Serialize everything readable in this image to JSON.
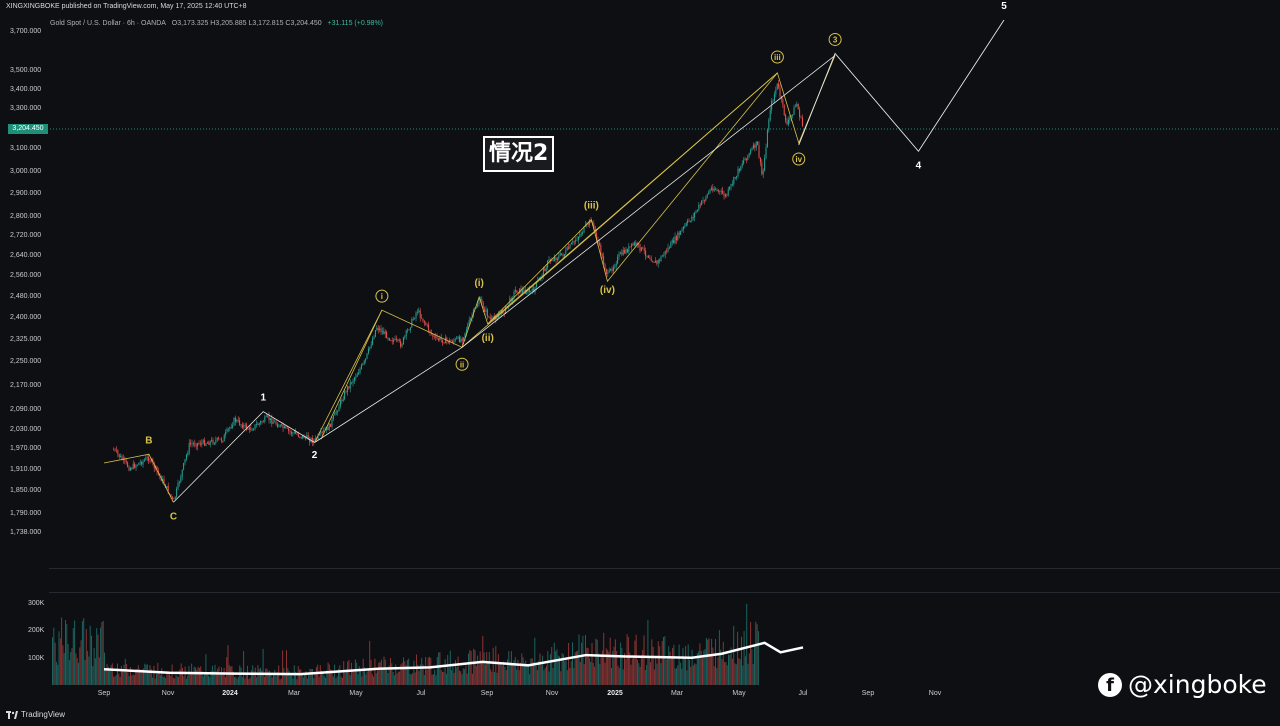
{
  "header": {
    "published": "XINGXINGBOKE published on TradingView.com, May 17, 2025 12:40 UTC+8",
    "symbol": "Gold Spot / U.S. Dollar · 6h · OANDA",
    "ohlc": "O3,173.325  H3,205.885  L3,172.815  C3,204.450",
    "change": "+31.115 (+0.98%)"
  },
  "overlay_title": "情况2",
  "brand": {
    "icon": "facebook-icon",
    "handle": "@xingboke"
  },
  "footer": {
    "logo": "TradingView"
  },
  "colors": {
    "background": "#0e0f12",
    "up": "#26a69a",
    "down": "#ef5350",
    "wave_yellow": "#d8c24a",
    "wave_white": "#e6e6e6",
    "current_price": "#1e8f78"
  },
  "chart_data": {
    "type": "candlestick",
    "title": "Gold Spot / U.S. Dollar · 6h · OANDA",
    "current_price": "3,204.450",
    "y_ticks": [
      "3,700.000",
      "3,500.000",
      "3,400.000",
      "3,300.000",
      "3,100.000",
      "3,000.000",
      "2,900.000",
      "2,800.000",
      "2,720.000",
      "2,640.000",
      "2,560.000",
      "2,480.000",
      "2,400.000",
      "2,325.000",
      "2,250.000",
      "2,170.000",
      "2,090.000",
      "2,030.000",
      "1,970.000",
      "1,910.000",
      "1,850.000",
      "1,790.000",
      "1,738.000"
    ],
    "x_ticks": [
      "Sep",
      "Nov",
      "2024",
      "Mar",
      "May",
      "Jul",
      "Sep",
      "Nov",
      "2025",
      "Mar",
      "May",
      "Jul",
      "Sep",
      "Nov"
    ],
    "volume_ticks": [
      "300K",
      "200K",
      "100K"
    ],
    "price_path": [
      [
        "2023-08-10",
        1968
      ],
      [
        "2023-08-25",
        1915
      ],
      [
        "2023-09-12",
        1945
      ],
      [
        "2023-09-28",
        1862
      ],
      [
        "2023-10-05",
        1820
      ],
      [
        "2023-10-20",
        1985
      ],
      [
        "2023-11-05",
        1990
      ],
      [
        "2023-11-20",
        2000
      ],
      [
        "2023-12-01",
        2060
      ],
      [
        "2023-12-15",
        2030
      ],
      [
        "2024-01-01",
        2065
      ],
      [
        "2024-01-20",
        2025
      ],
      [
        "2024-02-14",
        1995
      ],
      [
        "2024-02-28",
        2040
      ],
      [
        "2024-03-15",
        2160
      ],
      [
        "2024-04-01",
        2250
      ],
      [
        "2024-04-12",
        2370
      ],
      [
        "2024-04-25",
        2330
      ],
      [
        "2024-05-05",
        2310
      ],
      [
        "2024-05-20",
        2430
      ],
      [
        "2024-06-05",
        2330
      ],
      [
        "2024-06-20",
        2320
      ],
      [
        "2024-07-01",
        2330
      ],
      [
        "2024-07-17",
        2470
      ],
      [
        "2024-07-28",
        2390
      ],
      [
        "2024-08-10",
        2430
      ],
      [
        "2024-08-20",
        2505
      ],
      [
        "2024-09-05",
        2500
      ],
      [
        "2024-09-20",
        2620
      ],
      [
        "2024-10-05",
        2650
      ],
      [
        "2024-10-30",
        2790
      ],
      [
        "2024-11-14",
        2560
      ],
      [
        "2024-11-25",
        2640
      ],
      [
        "2024-12-10",
        2690
      ],
      [
        "2024-12-30",
        2610
      ],
      [
        "2025-01-15",
        2700
      ],
      [
        "2025-02-01",
        2800
      ],
      [
        "2025-02-20",
        2930
      ],
      [
        "2025-03-05",
        2890
      ],
      [
        "2025-03-20",
        3040
      ],
      [
        "2025-04-03",
        3130
      ],
      [
        "2025-04-08",
        2970
      ],
      [
        "2025-04-15",
        3300
      ],
      [
        "2025-04-22",
        3430
      ],
      [
        "2025-05-01",
        3220
      ],
      [
        "2025-05-10",
        3330
      ],
      [
        "2025-05-16",
        3204
      ]
    ],
    "volume_avg_path": [
      [
        "2023-08-01",
        58
      ],
      [
        "2023-10-01",
        45
      ],
      [
        "2023-12-01",
        42
      ],
      [
        "2024-02-01",
        40
      ],
      [
        "2024-04-15",
        60
      ],
      [
        "2024-06-01",
        65
      ],
      [
        "2024-07-20",
        85
      ],
      [
        "2024-09-01",
        72
      ],
      [
        "2024-10-25",
        110
      ],
      [
        "2024-12-01",
        105
      ],
      [
        "2025-02-01",
        100
      ],
      [
        "2025-03-01",
        115
      ],
      [
        "2025-04-10",
        155
      ],
      [
        "2025-04-25",
        120
      ],
      [
        "2025-05-16",
        138
      ]
    ],
    "wave_labels": [
      {
        "text": "B",
        "date": "2023-09-12",
        "price": 1955,
        "color": "yellow",
        "pos": "above"
      },
      {
        "text": "C",
        "date": "2023-10-05",
        "price": 1820,
        "color": "yellow",
        "pos": "below"
      },
      {
        "text": "1",
        "date": "2023-12-28",
        "price": 2085,
        "color": "white",
        "pos": "above"
      },
      {
        "text": "2",
        "date": "2024-02-14",
        "price": 1995,
        "color": "white",
        "pos": "below"
      },
      {
        "text": "i",
        "date": "2024-04-17",
        "price": 2430,
        "color": "yellow",
        "pos": "above",
        "circled": true
      },
      {
        "text": "ii",
        "date": "2024-07-01",
        "price": 2290,
        "color": "yellow",
        "pos": "below",
        "circled": true
      },
      {
        "text": "(i)",
        "date": "2024-07-17",
        "price": 2480,
        "color": "yellow",
        "pos": "above"
      },
      {
        "text": "(ii)",
        "date": "2024-07-25",
        "price": 2380,
        "color": "yellow",
        "pos": "below"
      },
      {
        "text": "(iii)",
        "date": "2024-10-30",
        "price": 2790,
        "color": "yellow",
        "pos": "above"
      },
      {
        "text": "(iv)",
        "date": "2024-11-14",
        "price": 2560,
        "color": "yellow",
        "pos": "below"
      },
      {
        "text": "iii",
        "date": "2025-04-22",
        "price": 3500,
        "color": "yellow",
        "pos": "above",
        "circled": true
      },
      {
        "text": "iv",
        "date": "2025-05-12",
        "price": 3120,
        "color": "yellow",
        "pos": "below",
        "circled": true
      },
      {
        "text": "3",
        "date": "2025-06-15",
        "price": 3590,
        "color": "yellow",
        "pos": "above",
        "circled": true
      },
      {
        "text": "4",
        "date": "2025-09-01",
        "price": 3090,
        "color": "white",
        "pos": "below"
      },
      {
        "text": "5",
        "date": "2025-11-20",
        "price": 3760,
        "color": "white",
        "pos": "above"
      }
    ],
    "projection_path": [
      [
        "2025-05-12",
        3120
      ],
      [
        "2025-06-15",
        3590
      ],
      [
        "2025-09-01",
        3090
      ],
      [
        "2025-11-20",
        3760
      ]
    ]
  }
}
